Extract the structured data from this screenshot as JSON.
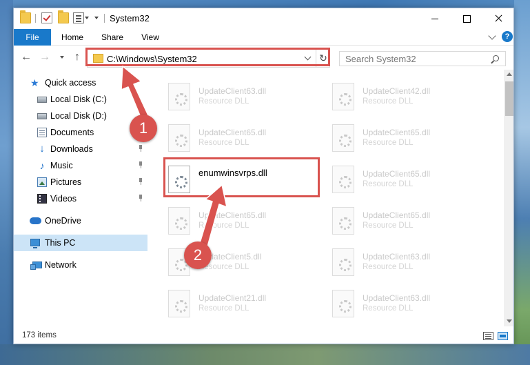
{
  "window": {
    "title": "System32",
    "minimize_label": "",
    "maximize_label": "",
    "close_label": ""
  },
  "ribbon": {
    "tabs": [
      "File",
      "Home",
      "Share",
      "View"
    ],
    "help": "?"
  },
  "navigation": {
    "back": "←",
    "forward": "→",
    "up": "↑",
    "address": "C:\\Windows\\System32",
    "refresh": "↻",
    "search_placeholder": "Search System32"
  },
  "sidebar": {
    "items": [
      {
        "label": "Quick access",
        "icon": "star-icon",
        "pinned": false
      },
      {
        "label": "Local Disk (C:)",
        "icon": "disk-icon",
        "pinned": false
      },
      {
        "label": "Local Disk (D:)",
        "icon": "disk-icon",
        "pinned": false
      },
      {
        "label": "Documents",
        "icon": "documents-icon",
        "pinned": true
      },
      {
        "label": "Downloads",
        "icon": "download-icon",
        "pinned": true
      },
      {
        "label": "Music",
        "icon": "music-icon",
        "pinned": true
      },
      {
        "label": "Pictures",
        "icon": "pictures-icon",
        "pinned": true
      },
      {
        "label": "Videos",
        "icon": "videos-icon",
        "pinned": true
      },
      {
        "label": "OneDrive",
        "icon": "onedrive-icon",
        "pinned": false
      },
      {
        "label": "This PC",
        "icon": "pc-icon",
        "pinned": false,
        "selected": true
      },
      {
        "label": "Network",
        "icon": "network-icon",
        "pinned": false
      }
    ]
  },
  "files": [
    {
      "name": "UpdateClient63.dll",
      "type": "Resource DLL"
    },
    {
      "name": "UpdateClient42.dll",
      "type": "Resource DLL"
    },
    {
      "name": "UpdateClient65.dll",
      "type": "Resource DLL"
    },
    {
      "name": "UpdateClient65.dll",
      "type": "Resource DLL"
    },
    {
      "name": "enumwinsvrps.dll",
      "type": "",
      "highlighted": true
    },
    {
      "name": "UpdateClient65.dll",
      "type": "Resource DLL"
    },
    {
      "name": "UpdateClient65.dll",
      "type": "Resource DLL"
    },
    {
      "name": "UpdateClient65.dll",
      "type": "Resource DLL"
    },
    {
      "name": "UpdateClient5.dll",
      "type": "Resource DLL"
    },
    {
      "name": "UpdateClient63.dll",
      "type": "Resource DLL"
    },
    {
      "name": "UpdateClient21.dll",
      "type": "Resource DLL"
    },
    {
      "name": "UpdateClient63.dll",
      "type": "Resource DLL"
    }
  ],
  "status": {
    "item_count": "173 items"
  },
  "annotations": {
    "step1": "1",
    "step2": "2",
    "color": "#d9534f"
  },
  "colors": {
    "accent": "#1979ca",
    "selection": "#cce4f7"
  }
}
